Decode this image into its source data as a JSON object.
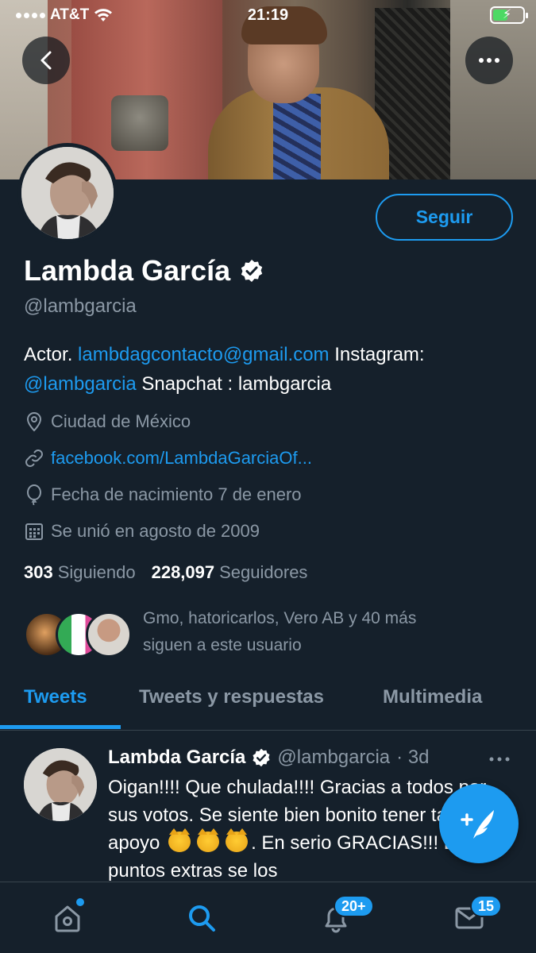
{
  "status": {
    "carrier": "AT&T",
    "time": "21:19"
  },
  "profile": {
    "name": "Lambda García",
    "handle": "@lambgarcia",
    "follow_label": "Seguir",
    "bio": {
      "prefix": "Actor. ",
      "email": "lambdagcontacto@gmail.com",
      "mid": " Instagram: ",
      "instagram": "@lambgarcia",
      "suffix": " Snapchat : lambgarcia"
    },
    "location": "Ciudad de México",
    "website": "facebook.com/LambdaGarciaOf...",
    "birthday": "Fecha de nacimiento 7 de enero",
    "joined": "Se unió en agosto de 2009",
    "following_count": "303",
    "following_label": "Siguiendo",
    "followers_count": "228,097",
    "followers_label": "Seguidores",
    "followed_by_line1": "Gmo, hatoricarlos, Vero AB y 40 más",
    "followed_by_line2": "siguen a este usuario"
  },
  "tabs": [
    "Tweets",
    "Tweets y respuestas",
    "Multimedia"
  ],
  "tweet": {
    "name": "Lambda García",
    "handle": "@lambgarcia",
    "time": "· 3d",
    "text_1": "Oigan!!!! Que chulada!!!! Gracias a todos por sus votos. Se siente bien bonito tener tanto apoyo",
    "text_2": ". En serio GRACIAS!!! Esos 4 puntos extras se los"
  },
  "nav": {
    "notifications_badge": "20+",
    "messages_badge": "15"
  },
  "colors": {
    "background": "#15202b",
    "accent": "#1d9bf0",
    "muted": "#8b98a5",
    "divider": "#38444d"
  }
}
